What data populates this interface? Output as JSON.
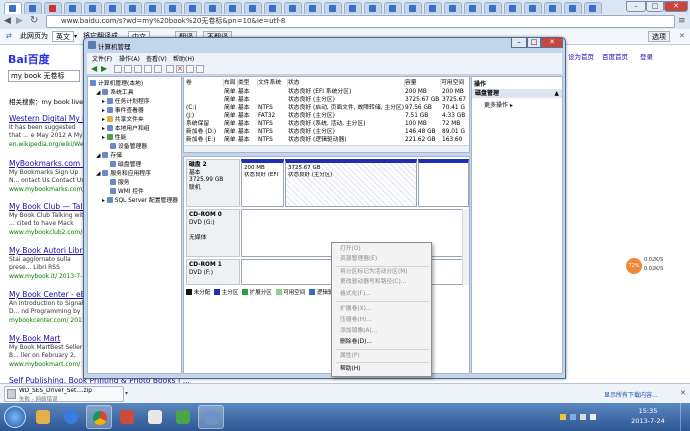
{
  "browser": {
    "url": "www.baidu.com/s?wd=my%20book%20无卷标&pn=10&ie=utf-8",
    "translate": {
      "text": "此网页为",
      "lang": "英文",
      "action": "将它翻译成",
      "target": "中文",
      "btn": "翻译",
      "btn_hide": "不翻译",
      "options": "选项"
    }
  },
  "baidu": {
    "logo": "Bai百度",
    "query": "my book 无卷标",
    "related": "相关搜索：my book live",
    "toplinks": [
      "设为首页",
      "百度首页",
      "登录"
    ]
  },
  "results": [
    {
      "title": "Western Digital My Book E",
      "body": "It has been suggested that ... e May 2012 A My Book Es...",
      "url": "en.wikipedia.org/wiki/Wester..."
    },
    {
      "title": "MyBookmarks.com - Welc",
      "body": "My Bookmarks Sign Up N... ontact Us Contact Us Abou...",
      "url": "www.mybookmarks.com/ 20..."
    },
    {
      "title": "My Book Club — Talking",
      "body": "My Book Club Talking with ... cited to have Mack Collier ...",
      "url": "www.mybookclub2.com/ 2013-..."
    },
    {
      "title": "My Book Autori Libri - Scri",
      "body": "Stai aggiornato sulla prese... Libri RSS Commenti R...",
      "url": "www.mybook.it/ 2013-7-23"
    },
    {
      "title": "My Book Center - eBook",
      "body": "An Introduction to Signal D... nd Programming by ...",
      "url": "mybookcenter.com/ 2013-..."
    },
    {
      "title": "My Book Mart",
      "body": "My Book MartBest Seller B... ller on February 2, 2012 The...",
      "url": "www.mybookmart.com/ 2..."
    },
    {
      "title": "Self Publishing, Book Printing & Photo Books | ..."
    }
  ],
  "mmc": {
    "title": "计算机管理",
    "menu": [
      "文件(F)",
      "操作(A)",
      "查看(V)",
      "帮助(H)"
    ],
    "tree": [
      {
        "label": "计算机管理(本地)",
        "level": 0
      },
      {
        "label": "系统工具",
        "level": 1
      },
      {
        "label": "任务计划程序",
        "level": 2
      },
      {
        "label": "事件查看器",
        "level": 2
      },
      {
        "label": "共享文件夹",
        "level": 2
      },
      {
        "label": "本地用户和组",
        "level": 2
      },
      {
        "label": "性能",
        "level": 2
      },
      {
        "label": "设备管理器",
        "level": 2
      },
      {
        "label": "存储",
        "level": 1
      },
      {
        "label": "磁盘管理",
        "level": 2
      },
      {
        "label": "服务和应用程序",
        "level": 1
      },
      {
        "label": "服务",
        "level": 2
      },
      {
        "label": "WMI 控件",
        "level": 2
      },
      {
        "label": "SQL Server 配置管理器",
        "level": 2
      }
    ],
    "columns": [
      "卷",
      "布局",
      "类型",
      "文件系统",
      "状态",
      "容量",
      "可用空间"
    ],
    "volumes": [
      {
        "vol": "",
        "layout": "简单",
        "type": "基本",
        "fs": "",
        "status": "状态良好 (EFI 系统分区)",
        "cap": "200 MB",
        "free": "200 MB"
      },
      {
        "vol": "",
        "layout": "简单",
        "type": "基本",
        "fs": "",
        "status": "状态良好 (主分区)",
        "cap": "3725.67 GB",
        "free": "3725.67"
      },
      {
        "vol": "(C:)",
        "layout": "简单",
        "type": "基本",
        "fs": "NTFS",
        "status": "状态良好 (启动, 页面文件, 故障转储, 主分区)",
        "cap": "97.56 GB",
        "free": "70.41 G"
      },
      {
        "vol": "(J:)",
        "layout": "简单",
        "type": "基本",
        "fs": "FAT32",
        "status": "状态良好 (主分区)",
        "cap": "7.51 GB",
        "free": "4.33 GB"
      },
      {
        "vol": "系统保留",
        "layout": "简单",
        "type": "基本",
        "fs": "NTFS",
        "status": "状态良好 (系统, 活动, 主分区)",
        "cap": "100 MB",
        "free": "72 MB"
      },
      {
        "vol": "新加卷 (D:)",
        "layout": "简单",
        "type": "基本",
        "fs": "NTFS",
        "status": "状态良好 (主分区)",
        "cap": "146.48 GB",
        "free": "89.01 G"
      },
      {
        "vol": "新加卷 (E:)",
        "layout": "简单",
        "type": "基本",
        "fs": "NTFS",
        "status": "状态良好 (逻辑驱动器)",
        "cap": "221.62 GB",
        "free": "163.60"
      }
    ],
    "disk2": {
      "name": "磁盘 2",
      "type": "基本",
      "size": "3725.99 GB",
      "state": "联机",
      "parts": [
        {
          "size": "200 MB",
          "status": "状态良好 (EFI"
        },
        {
          "size": "3725.67 GB",
          "status": "状态良好 (主分区)"
        },
        {
          "size": "",
          "status": ""
        }
      ]
    },
    "cdrom0": {
      "name": "CD-ROM 0",
      "drive": "DVD (G:)",
      "media": "无媒体"
    },
    "cdrom1": {
      "name": "CD-ROM 1",
      "drive": "DVD (F:)"
    },
    "legend": [
      "未分配",
      "主分区",
      "扩展分区",
      "可用空间",
      "逻辑驱动器"
    ],
    "actions": {
      "header": "操作",
      "section": "磁盘管理",
      "more": "更多操作"
    }
  },
  "ctxmenu": {
    "items": [
      {
        "label": "打开(O)",
        "enabled": false
      },
      {
        "label": "资源管理器(E)",
        "enabled": false
      },
      {
        "label": "将分区标记为活动分区(M)",
        "enabled": false
      },
      {
        "label": "更改驱动器号和路径(C)...",
        "enabled": false
      },
      {
        "label": "格式化(F)...",
        "enabled": false
      },
      {
        "label": "扩展卷(X)...",
        "enabled": false
      },
      {
        "label": "压缩卷(H)...",
        "enabled": false
      },
      {
        "label": "添加镜像(A)...",
        "enabled": false
      },
      {
        "label": "删除卷(D)...",
        "enabled": true
      },
      {
        "label": "属性(P)",
        "enabled": false
      },
      {
        "label": "帮助(H)",
        "enabled": true
      }
    ]
  },
  "download": {
    "file": "WD_SES_Driver_Set....zip",
    "status": "失败 - 网络错误",
    "showall": "显示所有下载内容..."
  },
  "netmeter": {
    "pct": "72%",
    "up": "0.02K/S",
    "down": "0.02K/S"
  },
  "clock": {
    "time": "15:35",
    "date": "2013-7-24"
  },
  "colors": {
    "accent": "#1f3f9a",
    "unalloc": "#111111",
    "primary": "#1e2fb5",
    "logical": "#3a6ac6"
  }
}
